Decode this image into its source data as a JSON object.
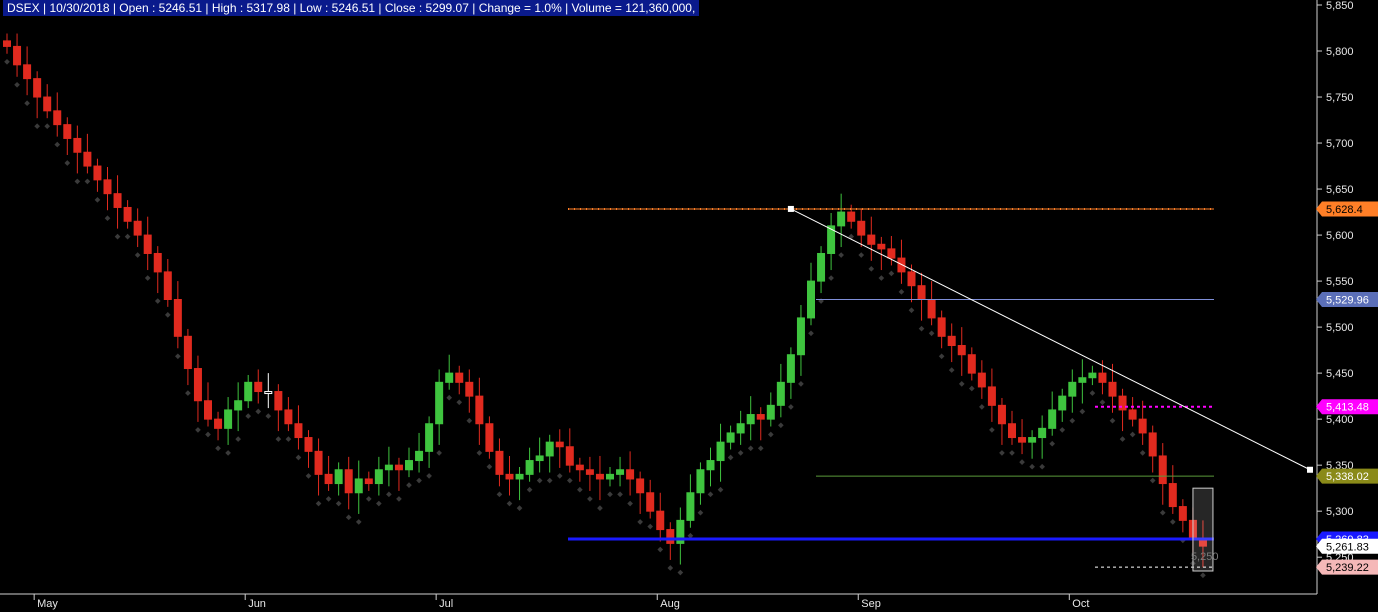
{
  "info_bar": {
    "text": "DSEX | 10/30/2018 | Open : 5246.51 | High : 5317.98 | Low : 5246.51 | Close : 5299.07 | Change = 1.0% | Volume = 121,360,000,"
  },
  "colors": {
    "background": "#000000",
    "info_bar_bg": "#0a1a8c",
    "bull": "#3fc43f",
    "bear": "#e12a1f",
    "neutral": "#ffffff",
    "resistance": "#ff7f27",
    "support": "#1a1aff",
    "magenta": "#ff00ff",
    "trendline": "#ffffff",
    "band_upper": "#7f8fd8",
    "band_lower": "#5a9a3a"
  },
  "chart_data": {
    "type": "candlestick",
    "symbol": "DSEX",
    "ylim": [
      5210,
      5850
    ],
    "y_ticks": [
      "5,850",
      "5,800",
      "5,750",
      "5,700",
      "5,650",
      "5,600",
      "5,550",
      "5,500",
      "5,450",
      "5,400",
      "5,350",
      "5,300",
      "5,250"
    ],
    "months": [
      {
        "label": "May",
        "index": 3
      },
      {
        "label": "Jun",
        "index": 24
      },
      {
        "label": "Jul",
        "index": 43
      },
      {
        "label": "Aug",
        "index": 65
      },
      {
        "label": "Sep",
        "index": 85
      },
      {
        "label": "Oct",
        "index": 106
      }
    ],
    "close": [
      5805,
      5785,
      5770,
      5750,
      5735,
      5720,
      5705,
      5690,
      5675,
      5660,
      5645,
      5630,
      5615,
      5600,
      5580,
      5560,
      5530,
      5490,
      5455,
      5420,
      5400,
      5390,
      5410,
      5420,
      5440,
      5430,
      5430,
      5410,
      5395,
      5380,
      5365,
      5340,
      5330,
      5345,
      5320,
      5335,
      5330,
      5345,
      5350,
      5345,
      5355,
      5365,
      5395,
      5440,
      5450,
      5440,
      5425,
      5395,
      5365,
      5340,
      5335,
      5340,
      5355,
      5360,
      5375,
      5370,
      5350,
      5345,
      5340,
      5335,
      5340,
      5345,
      5335,
      5320,
      5300,
      5280,
      5265,
      5290,
      5320,
      5345,
      5355,
      5375,
      5385,
      5395,
      5405,
      5400,
      5415,
      5440,
      5470,
      5510,
      5550,
      5580,
      5610,
      5625,
      5615,
      5600,
      5590,
      5585,
      5575,
      5560,
      5545,
      5530,
      5510,
      5490,
      5480,
      5470,
      5450,
      5435,
      5415,
      5395,
      5380,
      5375,
      5380,
      5390,
      5410,
      5425,
      5440,
      5445,
      5450,
      5440,
      5425,
      5410,
      5400,
      5385,
      5360,
      5330,
      5305,
      5290,
      5270,
      5262
    ],
    "series_labels": [
      {
        "name": "resistance",
        "value": "5,628.4"
      },
      {
        "name": "band_upper",
        "value": "5,529.96"
      },
      {
        "name": "magenta_level",
        "value": "5,413.48"
      },
      {
        "name": "band_lower",
        "value": "5,338.02"
      },
      {
        "name": "support",
        "value": "5,269.83"
      },
      {
        "name": "last_close",
        "value": "5,261.83"
      },
      {
        "name": "low_level",
        "value": "5,239.22"
      }
    ],
    "hidden_tag": "5,250"
  }
}
